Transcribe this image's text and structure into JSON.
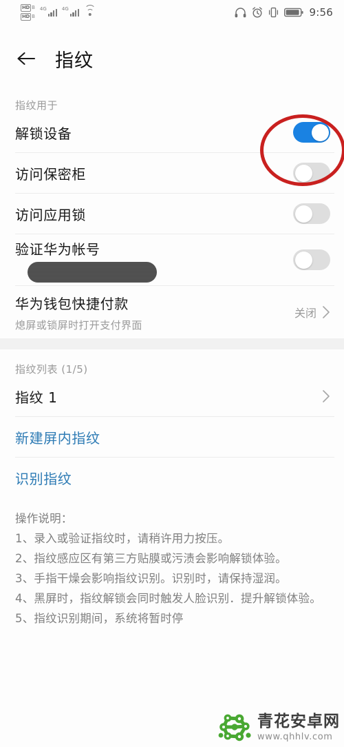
{
  "status_bar": {
    "hd_badges": [
      "HD",
      "HD"
    ],
    "network_labels": [
      "4G",
      "4G"
    ],
    "icons": [
      "hd-volte-icon",
      "hd-volte-icon",
      "signal-bars-icon",
      "signal-bars-icon",
      "wifi-icon",
      "headphones-icon",
      "alarm-icon",
      "vibrate-icon",
      "battery-icon"
    ],
    "time": "9:56"
  },
  "appbar": {
    "back_icon": "back-arrow-icon",
    "title": "指纹"
  },
  "usage_section": {
    "label": "指纹用于",
    "rows": [
      {
        "title": "解锁设备",
        "toggle": "on",
        "name": "unlock-device"
      },
      {
        "title": "访问保密柜",
        "toggle": "off",
        "name": "access-safe"
      },
      {
        "title": "访问应用锁",
        "toggle": "off",
        "name": "access-app-lock"
      },
      {
        "title": "验证华为帐号",
        "toggle": "off",
        "name": "verify-huawei-account",
        "redacted": true
      }
    ],
    "wallet_row": {
      "title": "华为钱包快捷付款",
      "subtitle": "熄屏或锁屏时打开支付界面",
      "value": "关闭"
    }
  },
  "fingerprint_section": {
    "label": "指纹列表 (1/5)",
    "items": [
      {
        "title": "指纹 1"
      }
    ],
    "links": [
      {
        "text": "新建屏内指纹"
      },
      {
        "text": "识别指纹"
      }
    ]
  },
  "instructions": {
    "heading": "操作说明：",
    "lines": [
      "1、录入或验证指纹时，请稍许用力按压。",
      "2、指纹感应区有第三方贴膜或污渍会影响解锁体验。",
      "3、手指干燥会影响指纹识别。识别时，请保持湿润。",
      "4、黑屏时，指纹解锁会同时触发人脸识别．提升解锁体验。",
      "5、指纹识别期间，系统将暂时停"
    ]
  },
  "watermark": {
    "name": "青花安卓网",
    "url": "www.qhhlv.com"
  },
  "colors": {
    "toggle_on": "#1a82e2",
    "toggle_off": "#dedede",
    "link_blue": "#2f7cb5",
    "annotation_red": "#c9201f",
    "logo_green": "#49a832"
  }
}
